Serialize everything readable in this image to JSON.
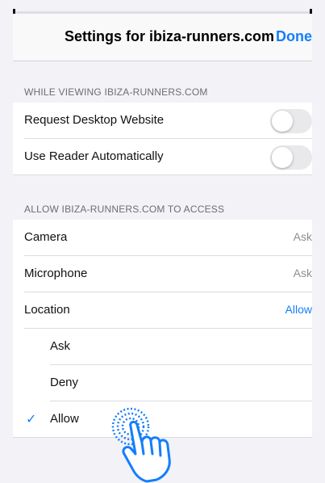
{
  "header": {
    "title": "Settings for ibiza-runners.com",
    "done_label": "Done"
  },
  "section_viewing": {
    "title": "WHILE VIEWING IBIZA-RUNNERS.COM",
    "items": [
      {
        "label": "Request Desktop Website",
        "enabled": false
      },
      {
        "label": "Use Reader Automatically",
        "enabled": false
      }
    ]
  },
  "section_access": {
    "title": "ALLOW IBIZA-RUNNERS.COM TO ACCESS",
    "items": [
      {
        "label": "Camera",
        "value": "Ask"
      },
      {
        "label": "Microphone",
        "value": "Ask"
      },
      {
        "label": "Location",
        "value": "Allow"
      }
    ],
    "location_options": [
      {
        "label": "Ask",
        "selected": false
      },
      {
        "label": "Deny",
        "selected": false
      },
      {
        "label": "Allow",
        "selected": true
      }
    ]
  },
  "glyphs": {
    "checkmark": "✓"
  },
  "colors": {
    "accent": "#147efb",
    "background": "#f2f2f7"
  }
}
